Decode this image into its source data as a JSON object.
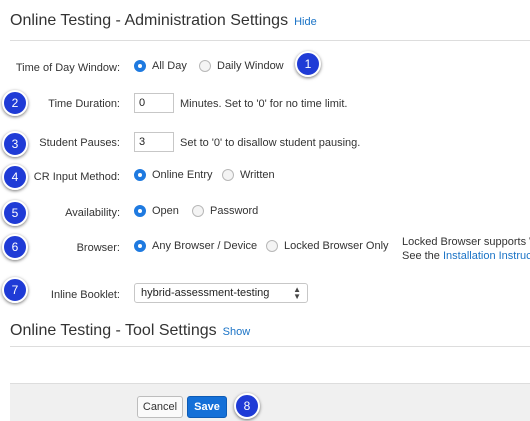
{
  "admin_section": {
    "title": "Online Testing - Administration Settings",
    "toggle_label": "Hide"
  },
  "time_of_day": {
    "label": "Time of Day Window:",
    "options": [
      {
        "label": "All Day",
        "selected": true
      },
      {
        "label": "Daily Window",
        "selected": false
      }
    ]
  },
  "time_duration": {
    "label": "Time Duration:",
    "value": "0",
    "hint": "Minutes.  Set to '0' for no time limit."
  },
  "student_pauses": {
    "label": "Student Pauses:",
    "value": "3",
    "hint": "Set to '0' to disallow student pausing."
  },
  "cr_input": {
    "label": "CR Input Method:",
    "options": [
      {
        "label": "Online Entry",
        "selected": true
      },
      {
        "label": "Written",
        "selected": false
      }
    ]
  },
  "availability": {
    "label": "Availability:",
    "options": [
      {
        "label": "Open",
        "selected": true
      },
      {
        "label": "Password",
        "selected": false
      }
    ]
  },
  "browser": {
    "label": "Browser:",
    "options": [
      {
        "label": "Any Browser / Device",
        "selected": true
      },
      {
        "label": "Locked Browser Only",
        "selected": false
      }
    ],
    "note_line1": "Locked Browser supports W",
    "note_line2_prefix": "See the ",
    "note_link": "Installation Instructi"
  },
  "inline_booklet": {
    "label": "Inline Booklet:",
    "selected": "hybrid-assessment-testing"
  },
  "tool_section": {
    "title": "Online Testing - Tool Settings",
    "toggle_label": "Show"
  },
  "footer": {
    "cancel_label": "Cancel",
    "save_label": "Save"
  },
  "callouts": [
    "1",
    "2",
    "3",
    "4",
    "5",
    "6",
    "7",
    "8"
  ],
  "colors": {
    "accent": "#1f7ae0",
    "link": "#1a73c6",
    "callout_badge": "#1f3bd6",
    "save_button": "#1470d8"
  }
}
